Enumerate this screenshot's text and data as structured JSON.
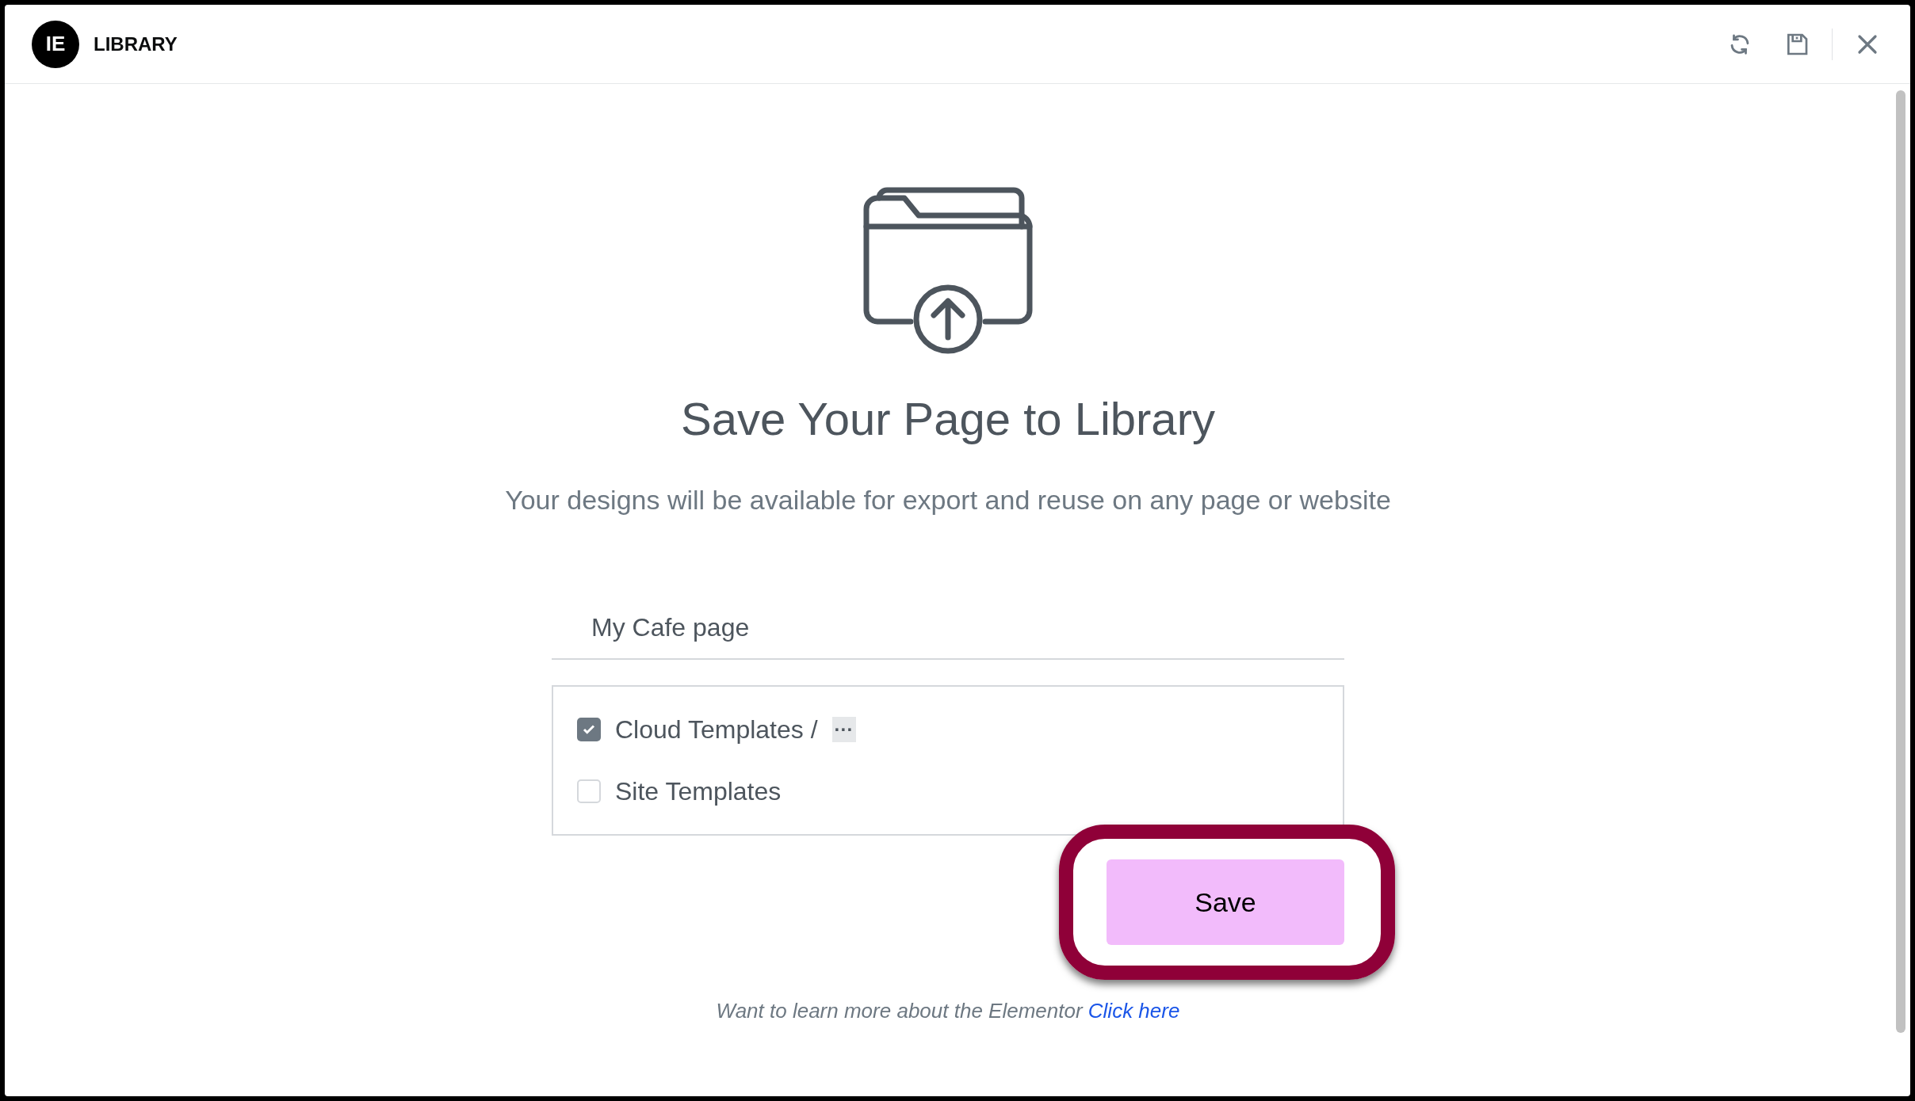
{
  "header": {
    "logo": "IE",
    "title": "LIBRARY"
  },
  "title": "Save Your Page to Library",
  "subtitle": "Your designs will be available for export and reuse on any page or website",
  "name_field": {
    "value": "My Cafe page"
  },
  "destinations": [
    {
      "label": "Cloud Templates /",
      "checked": true,
      "more": "···"
    },
    {
      "label": "Site Templates",
      "checked": false
    }
  ],
  "save_button": {
    "label": "Save",
    "highlighted": true
  },
  "footer": {
    "text": "Want to learn more about the Elementor",
    "link": "Click here"
  }
}
